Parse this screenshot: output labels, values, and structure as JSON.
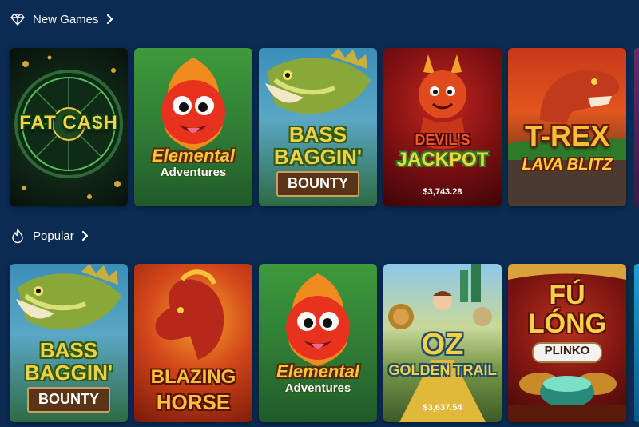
{
  "sections": [
    {
      "title": "New Games",
      "icon": "diamond-icon",
      "games": [
        {
          "logo_line1": "FAT CA$H",
          "logo_line2": "",
          "jackpot": ""
        },
        {
          "logo_line1": "Elemental",
          "logo_line2": "Adventures",
          "jackpot": ""
        },
        {
          "logo_line1": "BASS",
          "logo_line2": "BAGGIN'",
          "logo_line3": "BOUNTY",
          "jackpot": ""
        },
        {
          "logo_line1": "DEVIL'S",
          "logo_line2": "JACKPOT",
          "jackpot": "$3,743.28"
        },
        {
          "logo_line1": "T-REX",
          "logo_line2": "LAVA BLITZ",
          "jackpot": ""
        }
      ]
    },
    {
      "title": "Popular",
      "icon": "flame-icon",
      "games": [
        {
          "logo_line1": "BASS",
          "logo_line2": "BAGGIN'",
          "logo_line3": "BOUNTY",
          "jackpot": ""
        },
        {
          "logo_line1": "BLAZING",
          "logo_line2": "HORSE",
          "jackpot": ""
        },
        {
          "logo_line1": "Elemental",
          "logo_line2": "Adventures",
          "jackpot": ""
        },
        {
          "logo_line1": "OZ",
          "logo_line2": "GOLDEN TRAIL",
          "jackpot": "$3,637.54"
        },
        {
          "logo_line1": "FÚ",
          "logo_line2": "LÓNG",
          "logo_line3": "PLINKO",
          "jackpot": ""
        }
      ]
    }
  ],
  "colors": {
    "background": "#0b2b52",
    "text": "#ffffff"
  }
}
